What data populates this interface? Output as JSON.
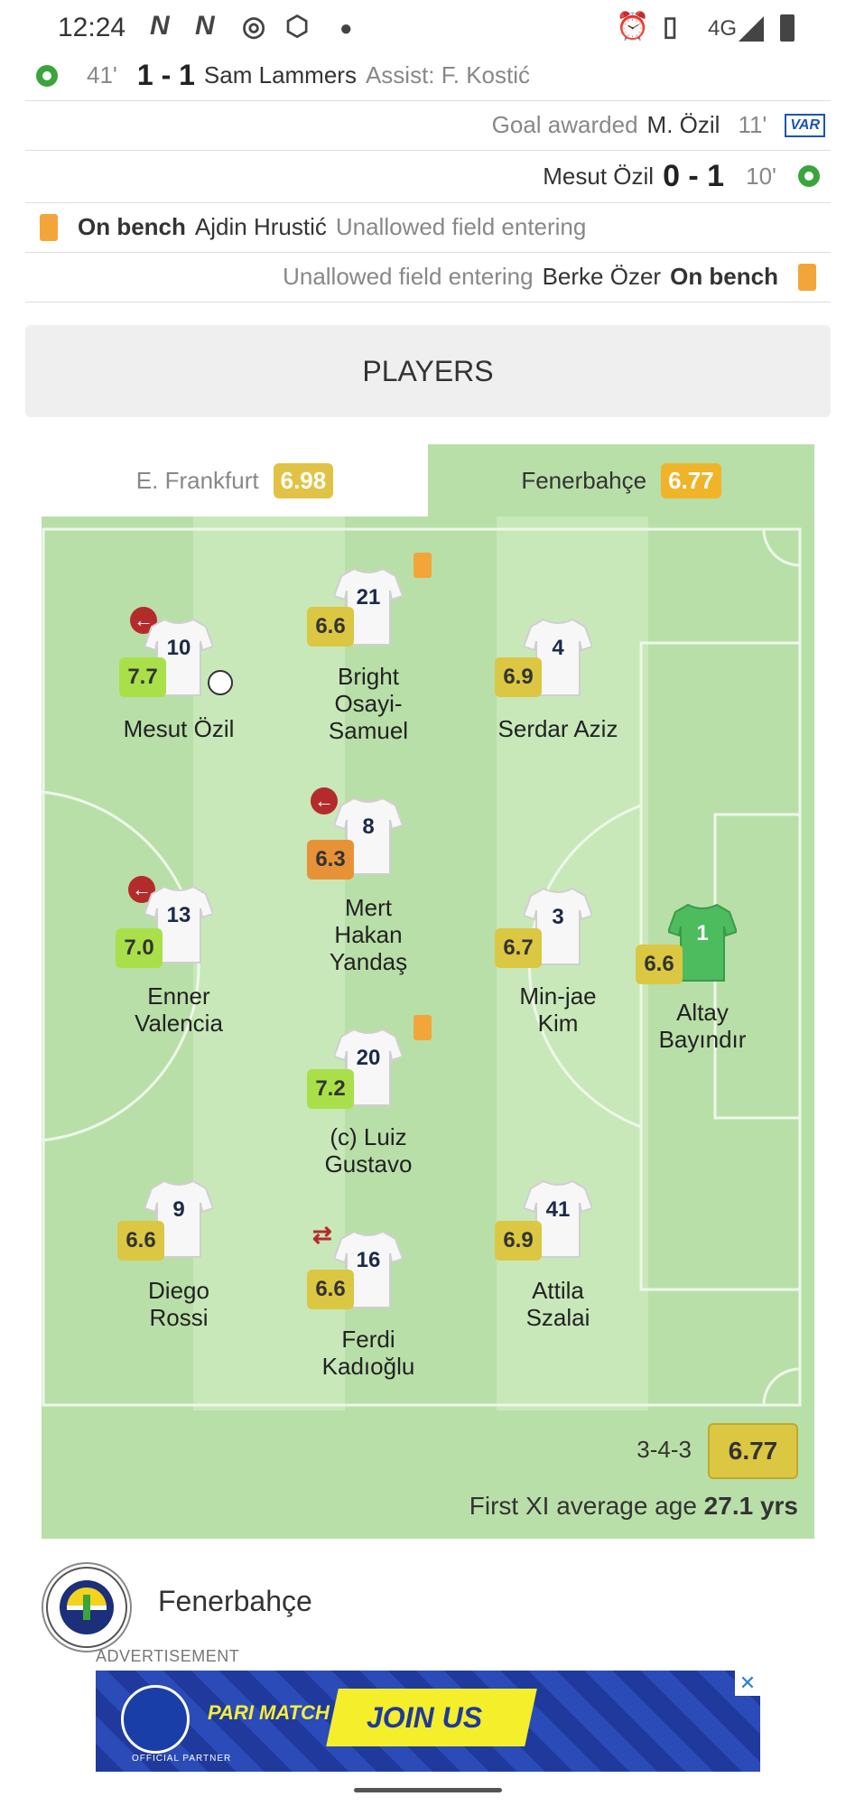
{
  "status_bar": {
    "time": "12:24",
    "network": "4G"
  },
  "events": [
    {
      "minute": "41'",
      "score": "1 - 1",
      "player": "Sam Lammers",
      "detail": "Assist: F. Kostić",
      "icon": "goal-ball-icon"
    },
    {
      "label": "Goal awarded",
      "player": "M. Özil",
      "minute": "11'",
      "badge": "VAR"
    },
    {
      "player": "Mesut Özil",
      "score": "0 - 1",
      "minute": "10'",
      "icon": "goal-ball-icon"
    },
    {
      "status": "On bench",
      "player": "Ajdin Hrustić",
      "reason": "Unallowed field entering",
      "icon": "yellow-card-icon"
    },
    {
      "reason": "Unallowed field entering",
      "player": "Berke Özer",
      "status": "On bench",
      "icon": "yellow-card-icon"
    }
  ],
  "players_header": "PLAYERS",
  "tabs": [
    {
      "team": "E. Frankfurt",
      "rating": "6.98"
    },
    {
      "team": "Fenerbahçe",
      "rating": "6.77"
    }
  ],
  "lineup": [
    {
      "number": "10",
      "name": "Mesut Özil",
      "rating": "7.7",
      "rating_color": "green",
      "subbed_off": true,
      "goal": true
    },
    {
      "number": "21",
      "name": "Bright Osayi-Samuel",
      "rating": "6.6",
      "rating_color": "yellow",
      "yellow_card": true
    },
    {
      "number": "4",
      "name": "Serdar Aziz",
      "rating": "6.9",
      "rating_color": "yellow"
    },
    {
      "number": "8",
      "name": "Mert Hakan Yandaş",
      "rating": "6.3",
      "rating_color": "orange",
      "subbed_off": true
    },
    {
      "number": "13",
      "name": "Enner Valencia",
      "rating": "7.0",
      "rating_color": "green",
      "subbed_off": true
    },
    {
      "number": "3",
      "name": "Min-jae Kim",
      "rating": "6.7",
      "rating_color": "yellow"
    },
    {
      "number": "1",
      "name": "Altay Bayındır",
      "rating": "6.6",
      "rating_color": "yellow",
      "goalkeeper": true
    },
    {
      "number": "20",
      "name": "(c) Luiz Gustavo",
      "rating": "7.2",
      "rating_color": "green",
      "yellow_card": true
    },
    {
      "number": "9",
      "name": "Diego Rossi",
      "rating": "6.6",
      "rating_color": "yellow"
    },
    {
      "number": "16",
      "name": "Ferdi Kadıoğlu",
      "rating": "6.6",
      "rating_color": "yellow",
      "injury_sub": true
    },
    {
      "number": "41",
      "name": "Attila Szalai",
      "rating": "6.9",
      "rating_color": "yellow"
    }
  ],
  "formation": "3-4-3",
  "team_rating": "6.77",
  "age_label": "First XI average age",
  "age_value": "27.1 yrs",
  "team_name": "Fenerbahçe",
  "advertisement_label": "ADVERTISEMENT",
  "ad": {
    "cta": "JOIN US",
    "brand": "PARI MATCH",
    "partner_note": "OFFICIAL PARTNER"
  },
  "colors": {
    "pitch": "#b9dfa8",
    "rating_yellow": "#dbc742",
    "rating_green": "#a9e04a",
    "rating_orange": "#e89238",
    "card": "#f2a63a",
    "keeper_shirt": "#4cbc5e"
  }
}
